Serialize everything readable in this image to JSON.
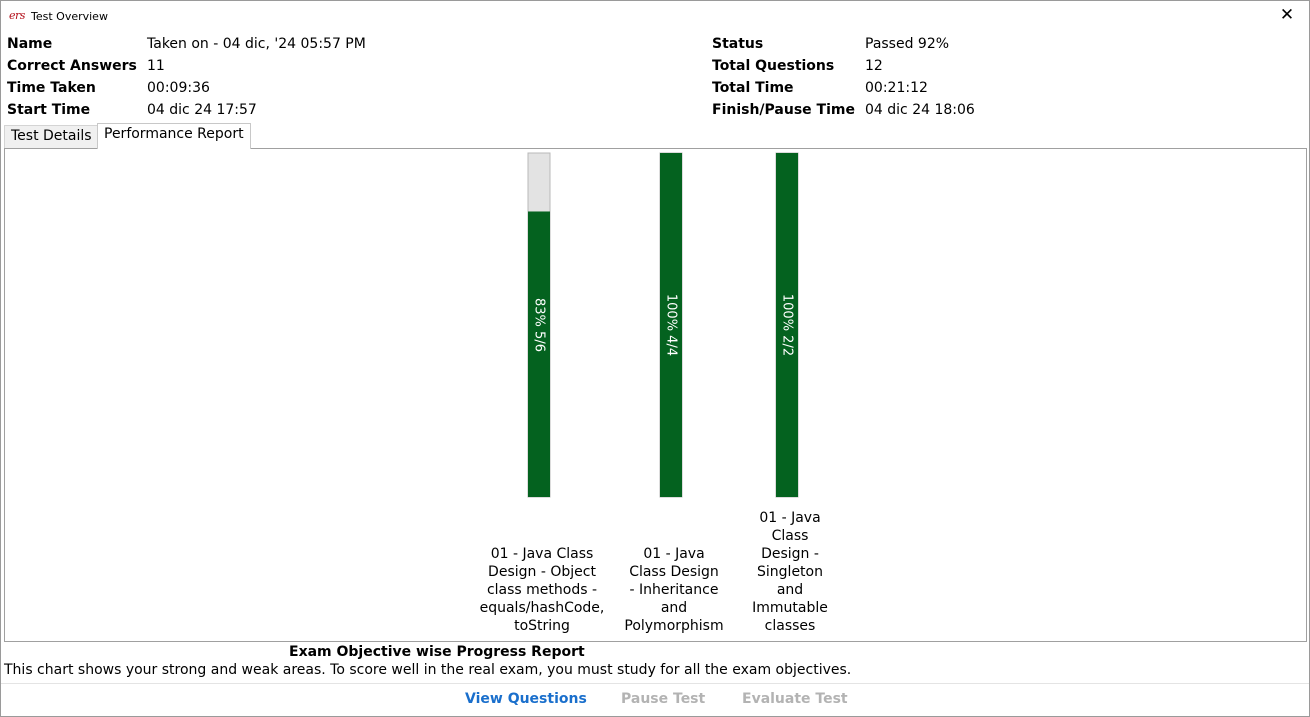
{
  "window": {
    "app_icon": "ers",
    "title": "Test Overview",
    "close_glyph": "✕"
  },
  "summary": {
    "left": [
      {
        "label": "Name",
        "value": "Taken on - 04 dic, '24 05:57 PM"
      },
      {
        "label": "Correct Answers",
        "value": "11"
      },
      {
        "label": "Time Taken",
        "value": "00:09:36"
      },
      {
        "label": "Start Time",
        "value": "04 dic 24 17:57"
      }
    ],
    "right": [
      {
        "label": "Status",
        "value": "Passed 92%"
      },
      {
        "label": "Total Questions",
        "value": "12"
      },
      {
        "label": "Total Time",
        "value": "00:21:12"
      },
      {
        "label": "Finish/Pause Time",
        "value": "04 dic 24 18:06"
      }
    ]
  },
  "tabs": [
    {
      "label": "Test Details",
      "active": false
    },
    {
      "label": "Performance Report",
      "active": true
    }
  ],
  "colors": {
    "bar_fill": "#04621f",
    "bar_track": "#e3e3e3",
    "link": "#1a6fcc",
    "disabled": "#b3b3b3"
  },
  "chart_data": {
    "type": "bar",
    "orientation": "vertical",
    "ylim": [
      0,
      100
    ],
    "categories": [
      "01 - Java Class Design - Object class methods - equals/hashCode, toString",
      "01 - Java Class Design - Inheritance and Polymorphism",
      "01 - Java Class Design - Singleton and Immutable classes"
    ],
    "values": [
      83,
      100,
      100
    ],
    "data_labels": [
      "83% 5/6",
      "100% 4/4",
      "100% 2/2"
    ],
    "category_lines": [
      [
        "01 - Java Class",
        "Design - Object",
        "class methods -",
        "equals/hashCode,",
        "toString"
      ],
      [
        "01 - Java",
        "Class Design",
        "- Inheritance",
        "and",
        "Polymorphism"
      ],
      [
        "01 - Java",
        "Class",
        "Design -",
        "Singleton",
        "and",
        "Immutable",
        "classes"
      ]
    ]
  },
  "report": {
    "title": "Exam Objective wise Progress Report",
    "description": "This chart shows your strong and weak areas. To score well in the real exam, you must study for all the exam objectives."
  },
  "actions": {
    "view_questions": "View Questions",
    "pause_test": "Pause Test",
    "evaluate_test": "Evaluate Test"
  }
}
